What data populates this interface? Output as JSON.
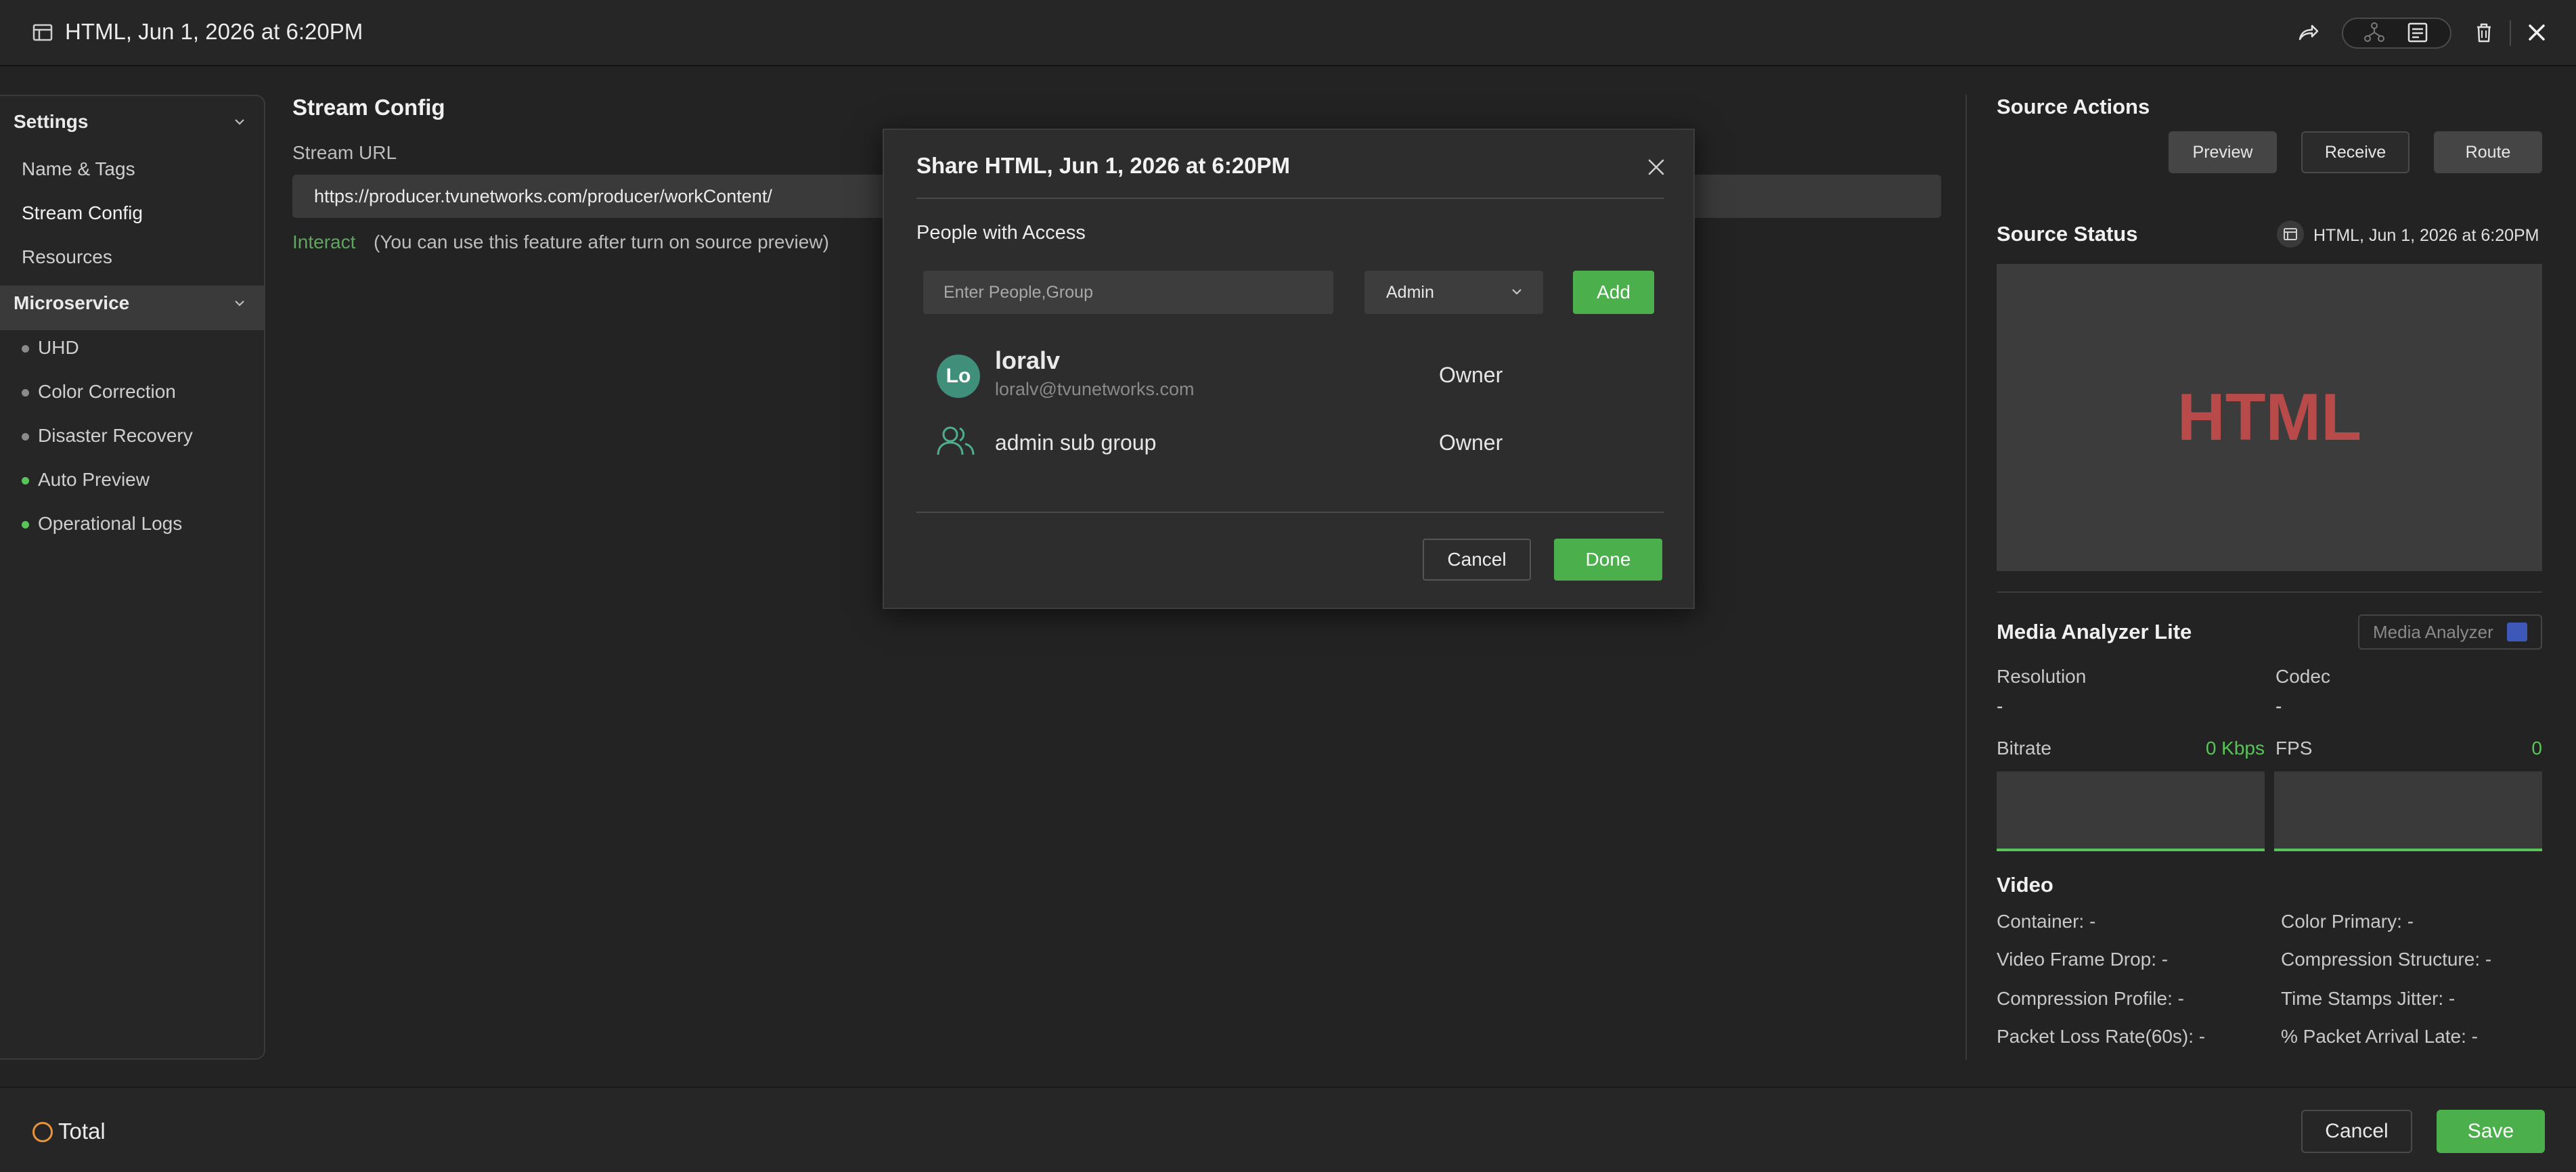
{
  "window": {
    "title": "HTML, Jun 1, 2026 at 6:20PM",
    "icons": [
      "panel-icon",
      "share-icon",
      "network-icon",
      "document-icon",
      "trash-icon",
      "close-icon"
    ]
  },
  "sidebar": {
    "settings_header": "Settings",
    "settings_items": [
      {
        "label": "Name & Tags"
      },
      {
        "label": "Stream Config",
        "active": true
      },
      {
        "label": "Resources"
      }
    ],
    "microservice_header": "Microservice",
    "microservice_items": [
      {
        "label": "UHD",
        "status": "inactive"
      },
      {
        "label": "Color Correction",
        "status": "inactive"
      },
      {
        "label": "Disaster Recovery",
        "status": "inactive"
      },
      {
        "label": "Auto Preview",
        "status": "active"
      },
      {
        "label": "Operational Logs",
        "status": "active"
      }
    ]
  },
  "stream_config": {
    "title": "Stream Config",
    "url_label": "Stream URL",
    "url_value": "https://producer.tvunetworks.com/producer/workContent/",
    "interact_label": "Interact",
    "interact_note": "(You can use this feature after turn on source preview)"
  },
  "source_actions": {
    "title": "Source Actions",
    "buttons": [
      "Preview",
      "Receive",
      "Route"
    ]
  },
  "source_status": {
    "title": "Source Status",
    "source_name": "HTML, Jun 1, 2026 at 6:20PM",
    "preview_label": "HTML"
  },
  "media_analyzer": {
    "title": "Media Analyzer Lite",
    "button_label": "Media Analyzer",
    "resolution_label": "Resolution",
    "resolution_value": "-",
    "codec_label": "Codec",
    "codec_value": "-",
    "bitrate_label": "Bitrate",
    "bitrate_value": "0 Kbps",
    "fps_label": "FPS",
    "fps_value": "0"
  },
  "video": {
    "title": "Video",
    "left": [
      "Container: -",
      "Video Frame Drop: -",
      "Compression Profile: -",
      "Packet Loss Rate(60s): -"
    ],
    "right": [
      "Color Primary: -",
      "Compression Structure: -",
      "Time Stamps Jitter: -",
      "% Packet Arrival Late: -"
    ]
  },
  "bottom_bar": {
    "total_label": "Total",
    "cancel_label": "Cancel",
    "save_label": "Save"
  },
  "share_dialog": {
    "title": "Share HTML, Jun 1, 2026 at 6:20PM",
    "people_label": "People with Access",
    "input_placeholder": "Enter People,Group",
    "role_value": "Admin",
    "add_label": "Add",
    "users": [
      {
        "initials": "Lo",
        "name": "loralv",
        "email": "loralv@tvunetworks.com",
        "role": "Owner"
      },
      {
        "name": "admin sub group",
        "role": "Owner"
      }
    ],
    "cancel_label": "Cancel",
    "done_label": "Done"
  },
  "colors": {
    "accent_green": "#4bb04b",
    "preview_text": "#b84a4a",
    "avatar": "#3f8f7a",
    "total_icon": "#e8943a"
  }
}
